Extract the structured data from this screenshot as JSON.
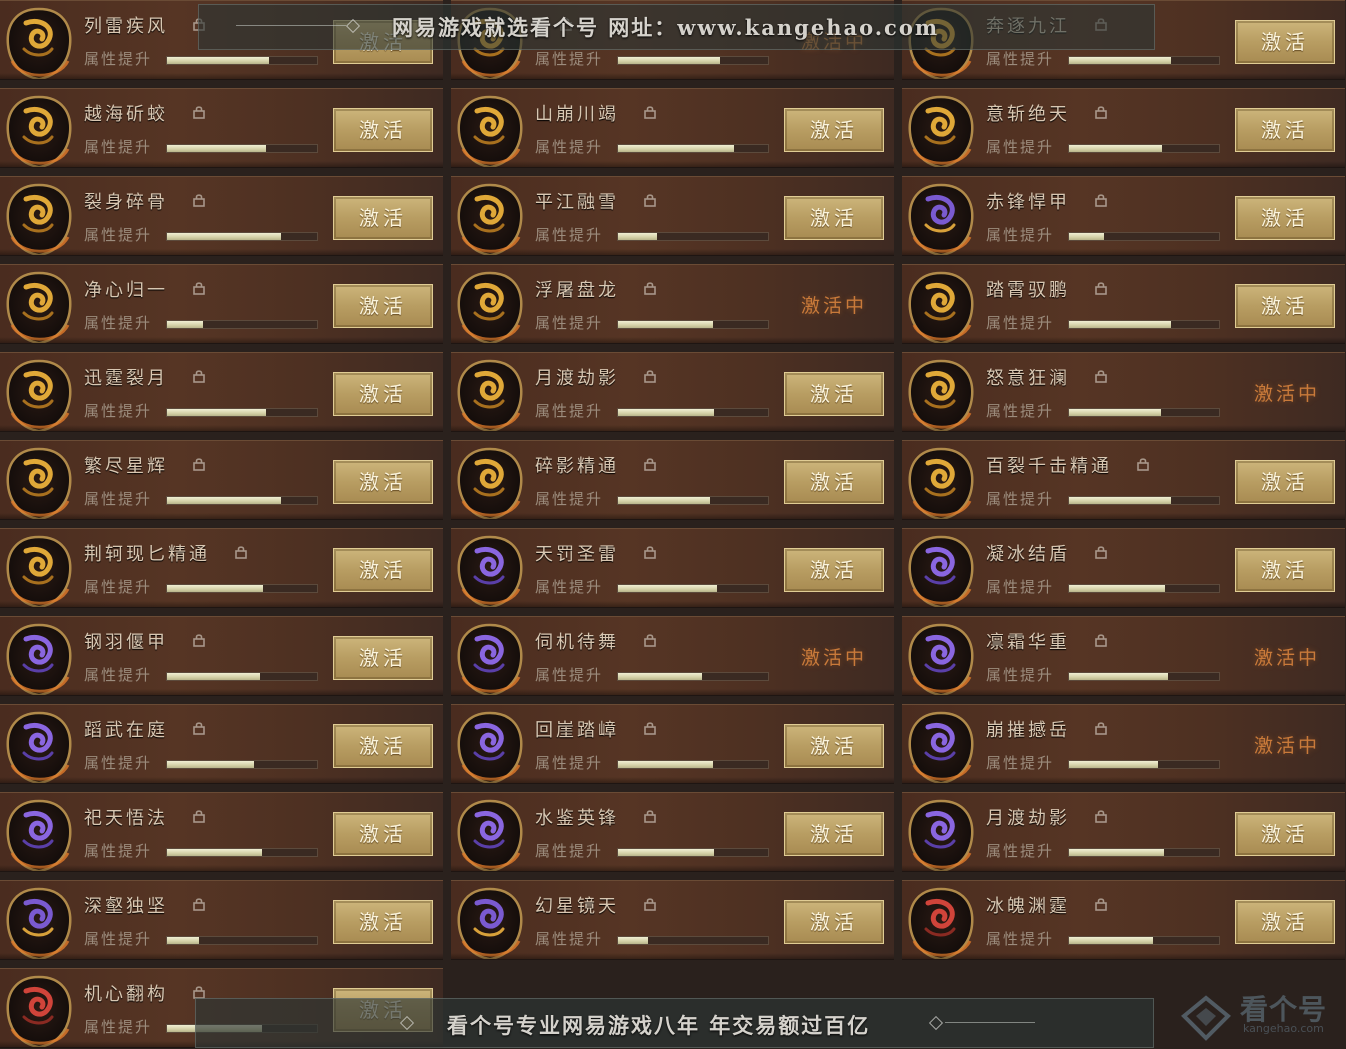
{
  "colors": {
    "card_bg": "#4e3022",
    "button_gold": "#b89d62",
    "active_orange": "#c97a3a",
    "bar_fill": "#e6e3c2",
    "emblem_gold": "#d8a13a",
    "emblem_purple": "#7a5ad0",
    "emblem_red": "#c8403a"
  },
  "labels": {
    "attribute": "属性提升",
    "activate": "激活",
    "activating": "激活中"
  },
  "cards": [
    {
      "name": "列雷疾风",
      "status": "activate",
      "progress": 0.68,
      "emblem": "gold-glyph-icon"
    },
    {
      "name": "",
      "status": "activating",
      "progress": 0.68,
      "emblem": "gold-glyph-icon"
    },
    {
      "name": "奔逐九江",
      "status": "activate",
      "progress": 0.68,
      "emblem": "gold-glyph-icon"
    },
    {
      "name": "越海斫蛟",
      "status": "activate",
      "progress": 0.66,
      "emblem": "gold-dragon-icon"
    },
    {
      "name": "山崩川竭",
      "status": "activate",
      "progress": 0.77,
      "emblem": "gold-flame-icon"
    },
    {
      "name": "意斩绝天",
      "status": "activate",
      "progress": 0.62,
      "emblem": "gold-blade-icon"
    },
    {
      "name": "裂身碎骨",
      "status": "activate",
      "progress": 0.76,
      "emblem": "gold-beast-icon"
    },
    {
      "name": "平江融雪",
      "status": "activate",
      "progress": 0.26,
      "emblem": "gold-swirl-icon"
    },
    {
      "name": "赤锋悍甲",
      "status": "activate",
      "progress": 0.23,
      "emblem": "purple-gold-armor-icon"
    },
    {
      "name": "净心归一",
      "status": "activate",
      "progress": 0.24,
      "emblem": "gold-lotus-icon"
    },
    {
      "name": "浮屠盘龙",
      "status": "activating",
      "progress": 0.63,
      "emblem": "gold-coiled-dragon-icon"
    },
    {
      "name": "踏霄驭鹏",
      "status": "activate",
      "progress": 0.68,
      "emblem": "gold-phoenix-icon"
    },
    {
      "name": "迅霆裂月",
      "status": "activate",
      "progress": 0.66,
      "emblem": "gold-crescent-icon"
    },
    {
      "name": "月渡劫影",
      "status": "activate",
      "progress": 0.64,
      "emblem": "gold-slash-icon"
    },
    {
      "name": "怒意狂澜",
      "status": "activating",
      "progress": 0.61,
      "emblem": "gold-vortex-icon"
    },
    {
      "name": "繁尽星辉",
      "status": "activate",
      "progress": 0.76,
      "emblem": "gold-spear-icon"
    },
    {
      "name": "碎影精通",
      "status": "activate",
      "progress": 0.61,
      "emblem": "gold-spiral-icon"
    },
    {
      "name": "百裂千击精通",
      "status": "activate",
      "progress": 0.68,
      "emblem": "gold-fang-icon"
    },
    {
      "name": "荆轲现匕精通",
      "status": "activate",
      "progress": 0.64,
      "emblem": "gold-dagger-icon"
    },
    {
      "name": "天罚圣雷",
      "status": "activate",
      "progress": 0.66,
      "emblem": "purple-thunder-icon"
    },
    {
      "name": "凝冰结盾",
      "status": "activate",
      "progress": 0.64,
      "emblem": "purple-shield-icon"
    },
    {
      "name": "钢羽偃甲",
      "status": "activate",
      "progress": 0.62,
      "emblem": "purple-feather-icon"
    },
    {
      "name": "伺机待舞",
      "status": "activating",
      "progress": 0.56,
      "emblem": "purple-dancer-icon"
    },
    {
      "name": "凛霜华重",
      "status": "activating",
      "progress": 0.66,
      "emblem": "purple-frost-icon"
    },
    {
      "name": "蹈武在庭",
      "status": "activate",
      "progress": 0.58,
      "emblem": "purple-wave-icon"
    },
    {
      "name": "回崖踏嶂",
      "status": "activate",
      "progress": 0.63,
      "emblem": "purple-cliff-icon"
    },
    {
      "name": "崩摧撼岳",
      "status": "activating",
      "progress": 0.59,
      "emblem": "purple-mountain-icon"
    },
    {
      "name": "祀天悟法",
      "status": "activate",
      "progress": 0.63,
      "emblem": "purple-rite-icon"
    },
    {
      "name": "水鉴英锋",
      "status": "activate",
      "progress": 0.64,
      "emblem": "purple-mirror-icon"
    },
    {
      "name": "月渡劫影",
      "status": "activate",
      "progress": 0.63,
      "emblem": "purple-slash-icon"
    },
    {
      "name": "深壑独坚",
      "status": "activate",
      "progress": 0.21,
      "emblem": "purple-gold-abyss-icon"
    },
    {
      "name": "幻星镜天",
      "status": "activate",
      "progress": 0.2,
      "emblem": "purple-gold-star-icon"
    },
    {
      "name": "冰魄渊霆",
      "status": "activate",
      "progress": 0.56,
      "emblem": "red-phoenix-icon"
    },
    {
      "name": "机心翻构",
      "status": "activate",
      "progress": 0.63,
      "emblem": "red-gear-icon"
    }
  ],
  "watermark": {
    "top": "网易游戏就选看个号  网址：www.kangehao.com",
    "bottom": "看个号专业网易游戏八年    年交易额过百亿",
    "logo": "看个号",
    "logo_sub": "kangehao.com"
  }
}
